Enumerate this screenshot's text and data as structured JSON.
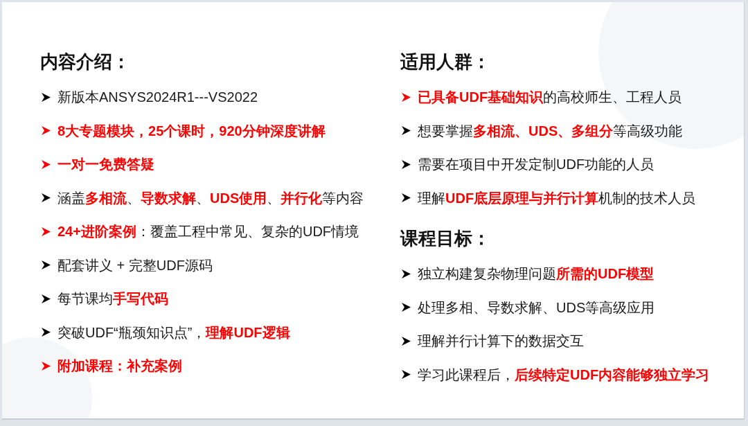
{
  "columns": [
    {
      "sections": [
        {
          "heading": "内容介绍：",
          "items": [
            {
              "text": "新版本ANSYS2024R1---VS2022",
              "color": "#000000"
            },
            {
              "text": "**8大专题模块，25个课时，920分钟深度讲解**",
              "color": "#ff0000"
            },
            {
              "text": "**一对一免费答疑**",
              "color": "#ff0000"
            },
            {
              "text": "涵盖**多相流**、**导数求解**、**UDS使用**、**并行化**等内容",
              "color": "#000000"
            },
            {
              "text": "**24+进阶案例**：覆盖工程中常见、复杂的UDF情境",
              "color": "#ff0000"
            },
            {
              "text": "配套讲义 + 完整UDF源码",
              "color": "#000000"
            },
            {
              "text": "每节课均**手写代码**",
              "color": "#000000"
            },
            {
              "text": "突破UDF“瓶颈知识点”，**理解UDF逻辑**",
              "color": "#000000"
            },
            {
              "text": "**附加课程：补充案例**",
              "color": "#ff0000"
            }
          ]
        }
      ]
    },
    {
      "sections": [
        {
          "heading": "适用人群：",
          "items": [
            {
              "text": "**已具备UDF基础知识**的高校师生、工程人员",
              "color": "#ff0000"
            },
            {
              "text": "想要掌握**多相流、UDS、多组分**等高级功能",
              "color": "#000000"
            },
            {
              "text": "需要在项目中开发定制UDF功能的人员",
              "color": "#000000"
            },
            {
              "text": "理解**UDF底层原理与并行计算**机制的技术人员",
              "color": "#000000"
            }
          ]
        },
        {
          "heading": "课程目标：",
          "items": [
            {
              "text": "独立构建复杂物理问题**所需的UDF模型**",
              "color": "#000000"
            },
            {
              "text": "处理多相、导数求解、UDS等高级应用",
              "color": "#000000"
            },
            {
              "text": "理解并行计算下的数据交互",
              "color": "#000000"
            },
            {
              "text": "学习此课程后，**后续特定UDF内容能够独立学习**",
              "color": "#000000"
            }
          ]
        }
      ]
    }
  ]
}
